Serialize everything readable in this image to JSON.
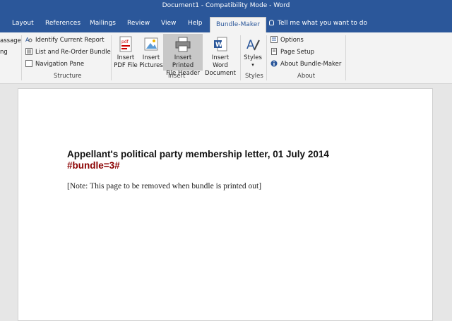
{
  "window": {
    "title": "Document1  -  Compatibility Mode  -  Word"
  },
  "tabs": [
    {
      "label": "Layout"
    },
    {
      "label": "References"
    },
    {
      "label": "Mailings"
    },
    {
      "label": "Review"
    },
    {
      "label": "View"
    },
    {
      "label": "Help"
    },
    {
      "label": "Bundle-Maker"
    }
  ],
  "tell_me": {
    "label": "Tell me what you want to do"
  },
  "ribbon": {
    "partial": {
      "item1": "assage",
      "item2": "ng"
    },
    "structure": {
      "label": "Structure",
      "identify": "Identify Current Report",
      "list_reorder": "List and Re-Order Bundle",
      "nav_pane": "Navigation Pane"
    },
    "insert": {
      "label": "Insert",
      "pdf": {
        "line1": "Insert",
        "line2": "PDF File"
      },
      "pictures": {
        "line1": "Insert",
        "line2": "Pictures"
      },
      "printed_header": {
        "line1": "Insert Printed",
        "line2": "File Header"
      },
      "word_doc": {
        "line1": "Insert Word",
        "line2": "Document"
      }
    },
    "styles": {
      "label": "Styles",
      "button": "Styles"
    },
    "about": {
      "label": "About",
      "options": "Options",
      "page_setup": "Page Setup",
      "about_bm": "About Bundle-Maker"
    }
  },
  "document": {
    "title": "Appellant's political party membership letter, 01 July 2014",
    "bundle": "#bundle=3#",
    "note": "[Note: This page to be removed when bundle is printed out]"
  }
}
